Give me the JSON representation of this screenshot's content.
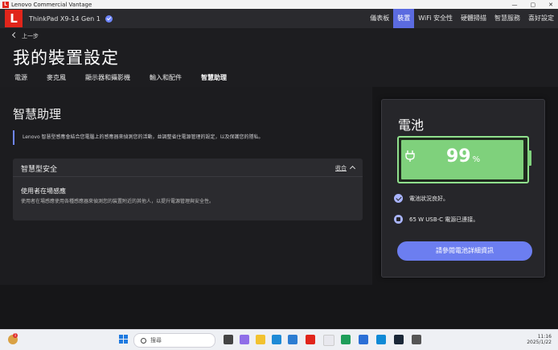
{
  "window": {
    "app_title": "Lenovo Commercial Vantage",
    "logo_letter": "L"
  },
  "nav": {
    "device_name": "ThinkPad X9-14 Gen 1",
    "tabs": [
      {
        "label": "儀表板"
      },
      {
        "label": "裝置",
        "active": true
      },
      {
        "label": "WiFi 安全性"
      },
      {
        "label": "硬體掃描"
      },
      {
        "label": "智慧服務"
      },
      {
        "label": "喜好設定"
      }
    ]
  },
  "header": {
    "back_label": "上一步",
    "page_title": "我的裝置設定",
    "subtabs": [
      {
        "label": "電源"
      },
      {
        "label": "麥克風"
      },
      {
        "label": "顯示器和攝影機"
      },
      {
        "label": "輸入和配件"
      },
      {
        "label": "智慧助理",
        "active": true
      }
    ]
  },
  "section": {
    "title": "智慧助理",
    "description": "Lenovo 智慧型感應會結合您電腦上的感應器來偵測您的活動，並調整省住電源管理的設定，以及保護您的隱私。",
    "card": {
      "title": "智慧型安全",
      "collapse_label": "收合",
      "item_title": "使用者在場感應",
      "item_subtitle": "使用者在場感應使用各種感應器來偵測您的裝置附近的其他人，以提升電源管理與安全性。"
    }
  },
  "battery": {
    "title": "電池",
    "percent": 99,
    "percent_unit": "%",
    "status_good": "電池狀況良好。",
    "status_adapter": "65 W USB-C 電源已連接。",
    "details_button": "請參閱電池詳細資訊",
    "fill_color": "#7fd17c"
  },
  "taskbar": {
    "search_placeholder": "搜尋",
    "weather_badge": "1",
    "clock_time": "11:16",
    "clock_date": "2025/1/22"
  },
  "colors": {
    "accent": "#5b6be0",
    "brand": "#e1251b"
  }
}
